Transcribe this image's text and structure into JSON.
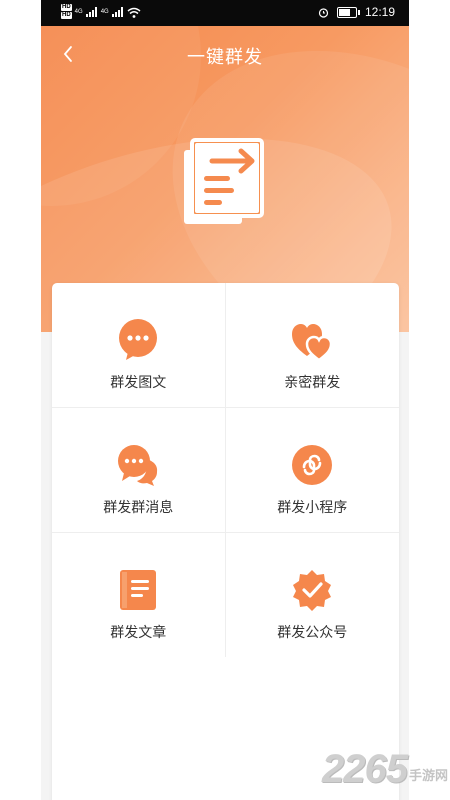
{
  "status_bar": {
    "hd_top": "HD",
    "hd_bottom": "HD",
    "network_1": "4G",
    "network_2": "4G",
    "time": "12:19"
  },
  "header": {
    "title": "一键群发"
  },
  "colors": {
    "accent": "#f5874c",
    "hero_start": "#f58a4e",
    "hero_end": "#fbc09a"
  },
  "menu": {
    "items": [
      {
        "label": "群发图文",
        "icon": "chat-dots-icon"
      },
      {
        "label": "亲密群发",
        "icon": "hearts-icon"
      },
      {
        "label": "群发群消息",
        "icon": "group-chat-icon"
      },
      {
        "label": "群发小程序",
        "icon": "mini-program-icon"
      },
      {
        "label": "群发文章",
        "icon": "article-icon"
      },
      {
        "label": "群发公众号",
        "icon": "verified-badge-icon"
      }
    ]
  },
  "watermark": {
    "number": "2265",
    "text": "手游网"
  }
}
